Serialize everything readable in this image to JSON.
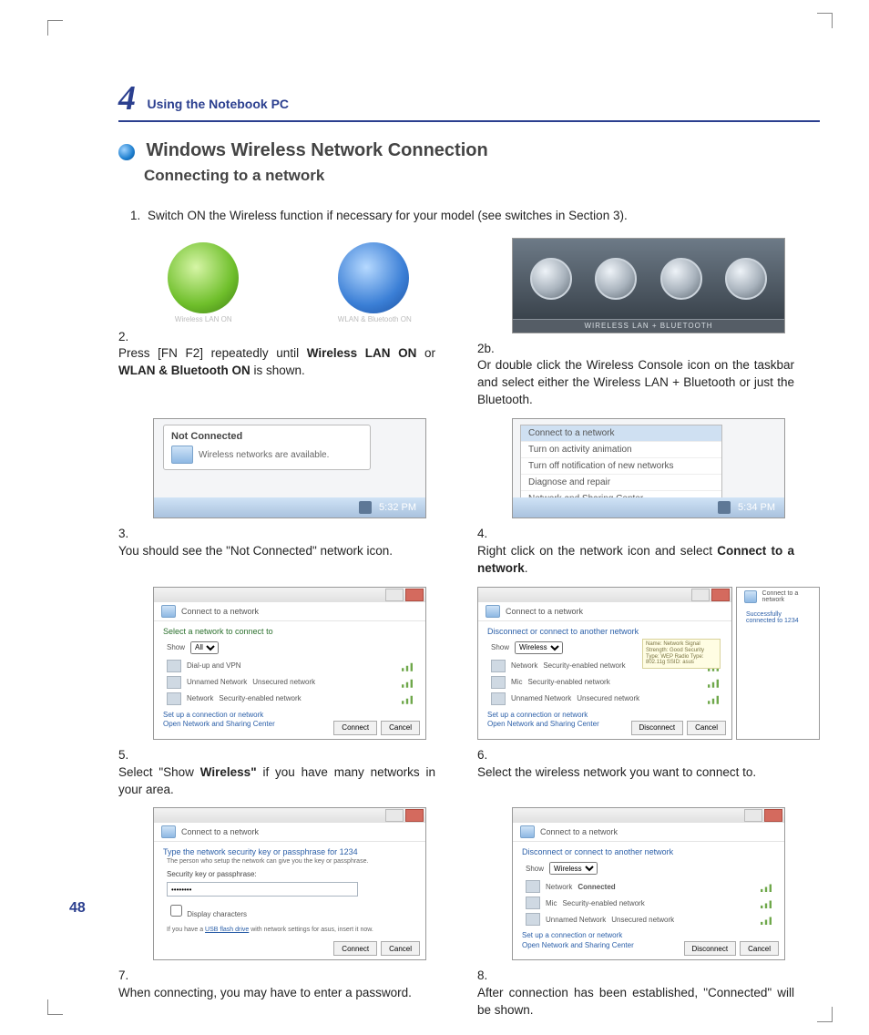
{
  "chapter": {
    "number": "4",
    "title": "Using the Notebook PC"
  },
  "section": {
    "title": "Windows Wireless Network Connection",
    "subtitle": "Connecting to a network"
  },
  "page_number": "48",
  "step1": "Switch ON the Wireless function if necessary for your model (see switches in Section 3).",
  "icons": {
    "wlan": "Wireless LAN ON",
    "wlanbt": "WLAN & Bluetooth ON"
  },
  "step2": {
    "n": "2.",
    "pre": "Press [FN F2] repeatedly until ",
    "b1": "Wireless LAN ON",
    "mid": " or ",
    "b2": "WLAN & Bluetooth ON",
    "post": " is shown."
  },
  "step2b": {
    "n": "2b.",
    "t": "Or double click the Wireless Console icon on the taskbar and select either the Wireless LAN + Bluetooth or just the Bluetooth.",
    "bar": "WIRELESS LAN + BLUETOOTH"
  },
  "step3": {
    "n": "3.",
    "t": "You should see the \"Not Connected\" network icon.",
    "popup_hd": "Not Connected",
    "popup_bd": "Wireless networks are available.",
    "time": "5:32 PM"
  },
  "step4": {
    "n": "4.",
    "pre": "Right click on the network icon and select ",
    "b": "Connect to a network",
    "post": ".",
    "menu": [
      "Connect to a network",
      "Turn on activity animation",
      "Turn off notification of new networks",
      "Diagnose and repair",
      "Network and Sharing Center"
    ],
    "time": "5:34 PM"
  },
  "step5": {
    "n": "5.",
    "pre": "Select \"Show ",
    "b": "Wireless\"",
    "post": " if you have many networks in your area.",
    "dlg": {
      "title": "Connect to a network",
      "h1": "Select a network to connect to",
      "show": "Show",
      "show_sel": "All",
      "rows": [
        {
          "name": "Dial-up and VPN",
          "type": ""
        },
        {
          "name": "Unnamed Network",
          "type": "Unsecured network"
        },
        {
          "name": "Network",
          "type": "Security-enabled network"
        }
      ],
      "link1": "Set up a connection or network",
      "link2": "Open Network and Sharing Center",
      "btn1": "Connect",
      "btn2": "Cancel"
    }
  },
  "step6": {
    "n": "6.",
    "t": "Select the wireless network you want to connect to.",
    "dlg": {
      "title": "Connect to a network",
      "h1": "Disconnect or connect to another network",
      "show": "Show",
      "show_sel": "Wireless",
      "rows": [
        {
          "name": "Network",
          "type": "Security-enabled network"
        },
        {
          "name": "Mic",
          "type": "Security-enabled network"
        },
        {
          "name": "Unnamed Network",
          "type": "Unsecured network"
        }
      ],
      "link1": "Set up a connection or network",
      "link2": "Open Network and Sharing Center",
      "btn1": "Disconnect",
      "btn2": "Cancel",
      "tip": "Name: Network\nSignal Strength: Good\nSecurity Type: WEP\nRadio Type: 802.11g\nSSID: asus"
    },
    "side": {
      "title": "Connect to a network",
      "msg": "Successfully connected to 1234"
    }
  },
  "step7": {
    "n": "7.",
    "t": "When connecting, you may have to enter a password.",
    "dlg": {
      "title": "Connect to a network",
      "h1": "Type the network security key or passphrase for 1234",
      "sub": "The person who setup the network can give you the key or passphrase.",
      "label": "Security key or passphrase:",
      "value": "••••••••",
      "chk": "Display characters",
      "note_pre": "If you have a ",
      "note_link": "USB flash drive",
      "note_post": " with network settings for asus, insert it now.",
      "btn1": "Connect",
      "btn2": "Cancel"
    }
  },
  "step8": {
    "n": "8.",
    "t": "After connection has been established, \"Connected\" will be shown.",
    "dlg": {
      "title": "Connect to a network",
      "h1": "Disconnect or connect to another network",
      "show": "Show",
      "show_sel": "Wireless",
      "rows": [
        {
          "name": "Network",
          "type": "Connected"
        },
        {
          "name": "Mic",
          "type": "Security-enabled network"
        },
        {
          "name": "Unnamed Network",
          "type": "Unsecured network"
        }
      ],
      "link1": "Set up a connection or network",
      "link2": "Open Network and Sharing Center",
      "btn1": "Disconnect",
      "btn2": "Cancel"
    }
  }
}
